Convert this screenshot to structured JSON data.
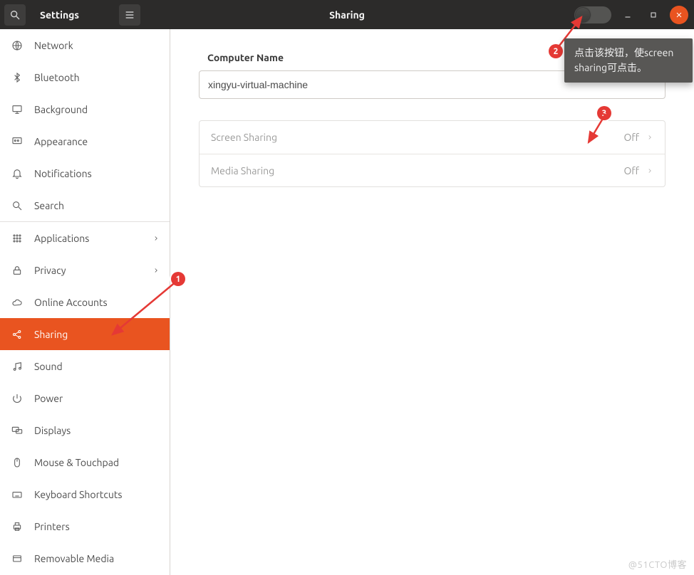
{
  "header": {
    "sidebar_title": "Settings",
    "page_title": "Sharing"
  },
  "sidebar": {
    "items": [
      {
        "icon": "globe",
        "label": "Network"
      },
      {
        "icon": "bluetooth",
        "label": "Bluetooth"
      },
      {
        "icon": "desktop",
        "label": "Background"
      },
      {
        "icon": "appearance",
        "label": "Appearance"
      },
      {
        "icon": "bell",
        "label": "Notifications"
      },
      {
        "icon": "search",
        "label": "Search"
      },
      {
        "icon": "apps",
        "label": "Applications",
        "chevron": true,
        "divider_before": true
      },
      {
        "icon": "lock",
        "label": "Privacy",
        "chevron": true
      },
      {
        "icon": "cloud",
        "label": "Online Accounts"
      },
      {
        "icon": "share",
        "label": "Sharing",
        "selected": true
      },
      {
        "icon": "music",
        "label": "Sound"
      },
      {
        "icon": "power",
        "label": "Power"
      },
      {
        "icon": "displays",
        "label": "Displays"
      },
      {
        "icon": "mouse",
        "label": "Mouse & Touchpad"
      },
      {
        "icon": "keyboard",
        "label": "Keyboard Shortcuts"
      },
      {
        "icon": "printer",
        "label": "Printers"
      },
      {
        "icon": "media",
        "label": "Removable Media"
      }
    ]
  },
  "content": {
    "computer_name_label": "Computer Name",
    "computer_name_value": "xingyu-virtual-machine",
    "rows": [
      {
        "label": "Screen Sharing",
        "state": "Off"
      },
      {
        "label": "Media Sharing",
        "state": "Off"
      }
    ]
  },
  "annotations": {
    "callout1": "1",
    "callout2": "2",
    "callout3": "3",
    "tooltip": "点击该按钮，使screen sharing可点击。"
  },
  "watermark": "@51CTO博客"
}
